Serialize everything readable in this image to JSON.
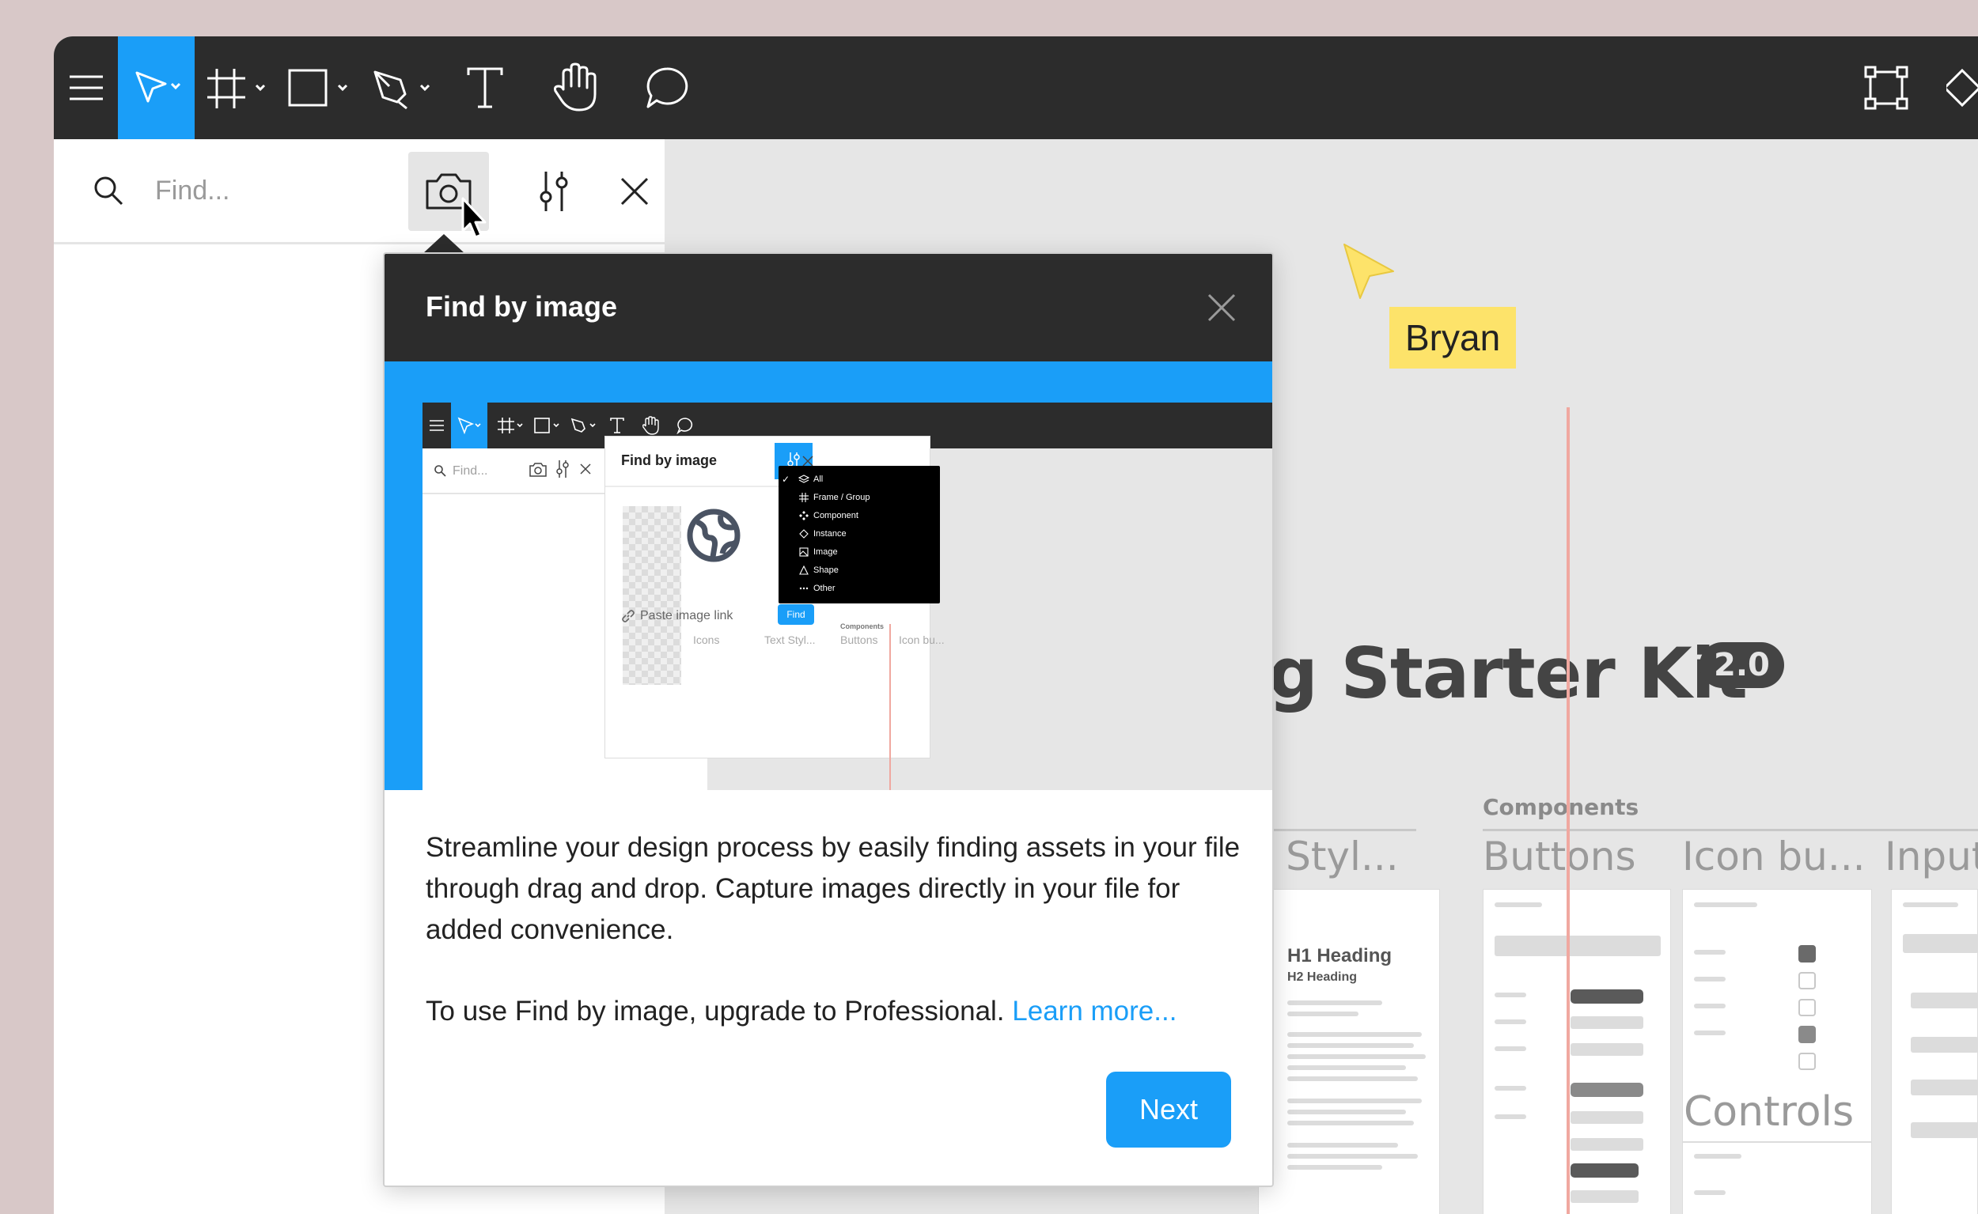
{
  "toolbar": {
    "tools": [
      "menu",
      "move",
      "frame",
      "shape",
      "pen",
      "text",
      "hand",
      "comment"
    ]
  },
  "search": {
    "placeholder": "Find..."
  },
  "collaborator": {
    "name": "Bryan",
    "color": "#fde36a"
  },
  "canvas": {
    "title": "ing Starter Kit",
    "version_badge": "2.0",
    "section_label": "Components",
    "columns": [
      "xt Styl...",
      "Buttons",
      "Icon bu...",
      "Input"
    ],
    "card_headings": [
      "H1 Heading",
      "H2 Heading"
    ],
    "controls_label": "Controls",
    "card_titles": [
      "Buttons",
      "Icon buttons",
      "Input fields",
      "Controls"
    ]
  },
  "modal": {
    "title": "Find by image",
    "description": "Streamline your design process by easily finding assets in your file through drag and drop. Capture images directly in your file for added convenience.",
    "upgrade_text": "To use Find by image, upgrade to Professional. ",
    "learn_more": "Learn more...",
    "next_label": "Next"
  },
  "preview": {
    "find_placeholder": "Find...",
    "panel_title": "Find by image",
    "paste_link": "Paste image link",
    "find_button": "Find",
    "menu_items": [
      {
        "label": "All",
        "checked": true,
        "icon": "layers-icon"
      },
      {
        "label": "Frame / Group",
        "checked": false,
        "icon": "frame-icon"
      },
      {
        "label": "Component",
        "checked": false,
        "icon": "component-icon"
      },
      {
        "label": "Instance",
        "checked": false,
        "icon": "instance-icon"
      },
      {
        "label": "Image",
        "checked": false,
        "icon": "image-icon"
      },
      {
        "label": "Shape",
        "checked": false,
        "icon": "shape-icon"
      },
      {
        "label": "Other",
        "checked": false,
        "icon": "more-icon"
      }
    ],
    "canvas_labels": [
      "Icons",
      "Text Styl...",
      "Buttons",
      "Icon bu..."
    ],
    "components_label": "Components"
  },
  "colors": {
    "accent": "#1a9ef8",
    "toolbar": "#2c2c2c",
    "canvas": "#e6e6e6",
    "backdrop": "#d8c8c8"
  }
}
